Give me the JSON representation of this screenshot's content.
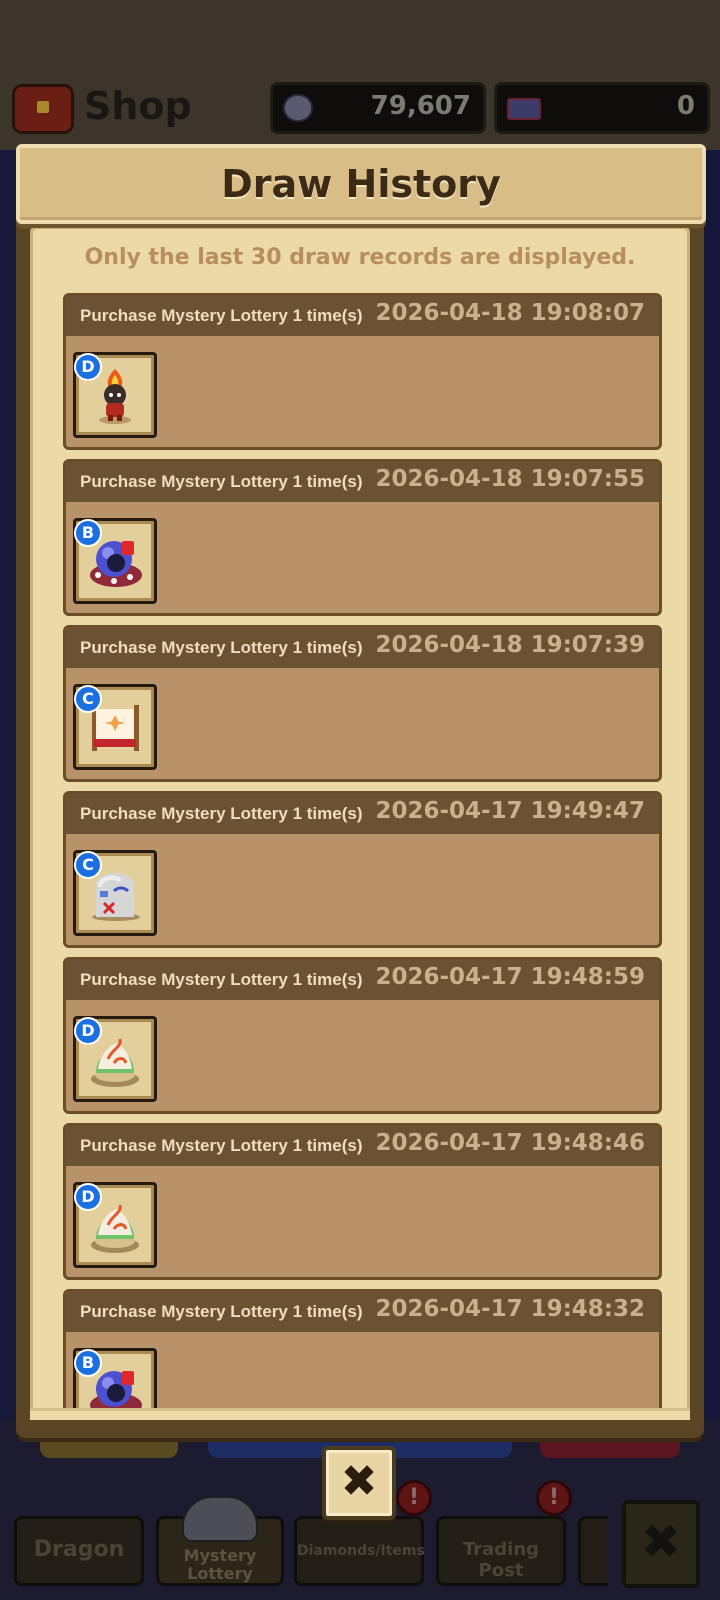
{
  "shop": {
    "title": "Shop",
    "gold_amount": "79,607",
    "gem_amount": "0",
    "tabs": {
      "dragon": "Dragon",
      "mystery_lottery": "Mystery Lottery",
      "diamonds_items": "Diamonds/Items",
      "trading_post": "Trading Post"
    },
    "badge_symbol": "!",
    "close_symbol": "✖"
  },
  "modal": {
    "title": "Draw History",
    "notice": "Only the last 30 draw records are displayed.",
    "close_symbol": "✖",
    "records": [
      {
        "label": "Purchase Mystery Lottery 1 time(s)",
        "time": "2026-04-18 19:08:07",
        "grade": "D",
        "item_icon": "fire-warrior-icon"
      },
      {
        "label": "Purchase Mystery Lottery 1 time(s)",
        "time": "2026-04-18 19:07:55",
        "grade": "B",
        "item_icon": "purple-orb-creature-icon"
      },
      {
        "label": "Purchase Mystery Lottery 1 time(s)",
        "time": "2026-04-18 19:07:39",
        "grade": "C",
        "item_icon": "flower-banner-icon"
      },
      {
        "label": "Purchase Mystery Lottery 1 time(s)",
        "time": "2026-04-17 19:49:47",
        "grade": "C",
        "item_icon": "stone-tombstone-icon"
      },
      {
        "label": "Purchase Mystery Lottery 1 time(s)",
        "time": "2026-04-17 19:48:59",
        "grade": "D",
        "item_icon": "swirl-dumpling-icon"
      },
      {
        "label": "Purchase Mystery Lottery 1 time(s)",
        "time": "2026-04-17 19:48:46",
        "grade": "D",
        "item_icon": "swirl-dumpling-icon"
      },
      {
        "label": "Purchase Mystery Lottery 1 time(s)",
        "time": "2026-04-17 19:48:32",
        "grade": "B",
        "item_icon": "purple-orb-creature-icon"
      }
    ]
  },
  "colors": {
    "grade_badge": "#1c6fe0",
    "record_bg": "#b8936a",
    "record_header": "#6b5232",
    "modal_paper": "#ebd9a7"
  }
}
